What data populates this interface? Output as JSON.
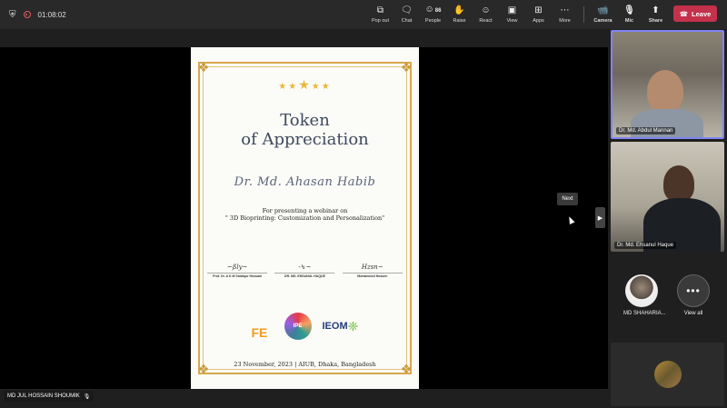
{
  "meeting": {
    "elapsed": "01:08:02"
  },
  "toolbar": {
    "popout": "Pop out",
    "chat": "Chat",
    "people": "People",
    "people_count": "86",
    "raise": "Raise",
    "react": "React",
    "view": "View",
    "apps": "Apps",
    "more": "More",
    "camera": "Camera",
    "mic": "Mic",
    "share": "Share",
    "leave": "Leave",
    "leave_color": "#c4314b"
  },
  "certificate": {
    "title_line1": "Token",
    "title_line2": "of Appreciation",
    "recipient": "Dr. Md. Ahasan Habib",
    "description_line1": "For presenting a webinar on",
    "description_line2": "\" 3D Bioprinting: Customization and Personalization\"",
    "signatories": [
      {
        "name": "Prof. Dr. A K M Siddiqur Hossain"
      },
      {
        "name": "DR. MD. EHSANUL HAQUE"
      },
      {
        "name": "Mohammed Hossen"
      }
    ],
    "logos": {
      "fe": "FE",
      "ipe": "IPE",
      "ieom": "IEOM"
    },
    "footer_date": "23  November, 2023",
    "footer_place": "| AIUB, Dhaka, Bangladesh",
    "accent_color": "#d7a84a"
  },
  "stage": {
    "next_tooltip": "Next"
  },
  "participants": {
    "tile1_name": "Dr. Md. Abdul Mannan",
    "tile2_name": "Dr. Md. Ehsanul Haque",
    "avatar_name": "MD SHAHARIA...",
    "view_all": "View all",
    "presenter_name": "MD JUL HOSSAIN SHOUMIK"
  }
}
